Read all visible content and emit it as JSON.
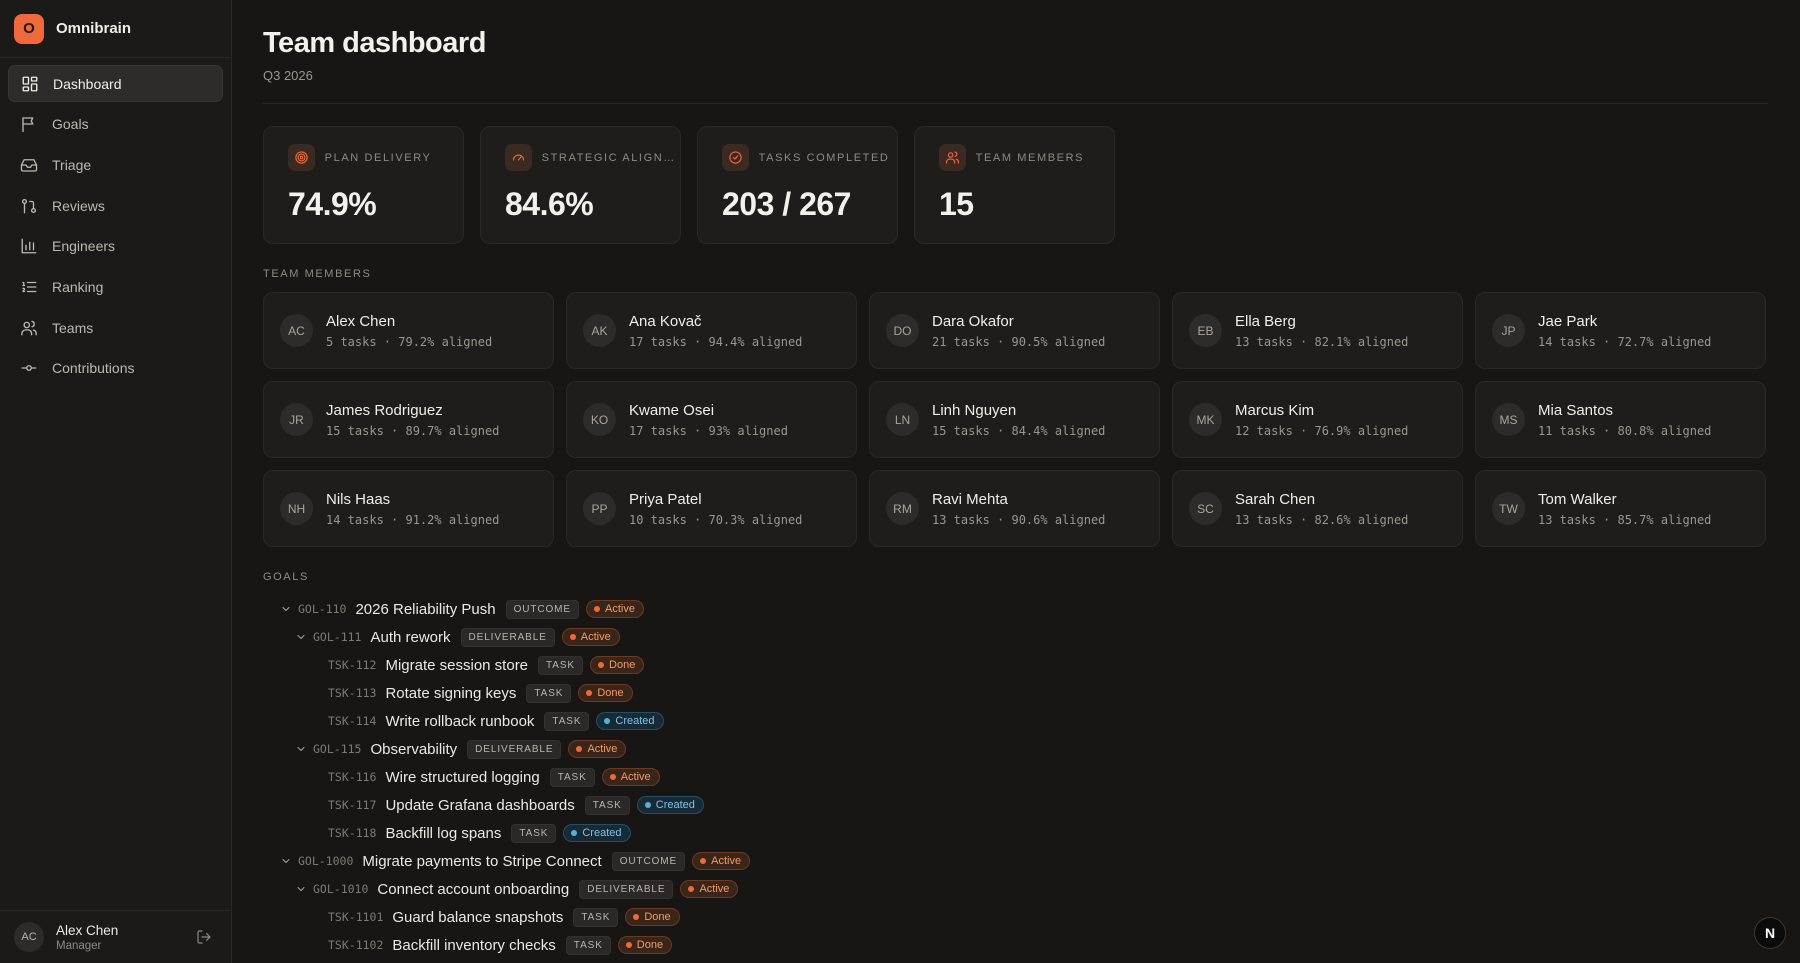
{
  "brand": {
    "logo_letter": "O",
    "name": "Omnibrain",
    "accent": "#f0693a"
  },
  "sidebar": {
    "items": [
      {
        "label": "Dashboard",
        "icon": "dashboard-icon",
        "active": true
      },
      {
        "label": "Goals",
        "icon": "flag-icon"
      },
      {
        "label": "Triage",
        "icon": "inbox-icon"
      },
      {
        "label": "Reviews",
        "icon": "git-pull-request-icon"
      },
      {
        "label": "Engineers",
        "icon": "bar-chart-icon"
      },
      {
        "label": "Ranking",
        "icon": "list-ordered-icon"
      },
      {
        "label": "Teams",
        "icon": "users-icon"
      },
      {
        "label": "Contributions",
        "icon": "git-commit-icon"
      }
    ]
  },
  "user": {
    "initials": "AC",
    "name": "Alex Chen",
    "role": "Manager"
  },
  "header": {
    "title": "Team dashboard",
    "subtitle": "Q3 2026"
  },
  "stats": [
    {
      "label": "PLAN DELIVERY",
      "value": "74.9%",
      "icon": "target-icon"
    },
    {
      "label": "STRATEGIC ALIGNMENT",
      "value": "84.6%",
      "icon": "gauge-icon"
    },
    {
      "label": "TASKS COMPLETED",
      "value": "203 / 267",
      "icon": "check-circle-icon"
    },
    {
      "label": "TEAM MEMBERS",
      "value": "15",
      "icon": "users-icon"
    }
  ],
  "members_section": {
    "label": "TEAM MEMBERS"
  },
  "members": [
    {
      "initials": "AC",
      "name": "Alex Chen",
      "meta": "5 tasks · 79.2% aligned"
    },
    {
      "initials": "AK",
      "name": "Ana Kovač",
      "meta": "17 tasks · 94.4% aligned"
    },
    {
      "initials": "DO",
      "name": "Dara Okafor",
      "meta": "21 tasks · 90.5% aligned"
    },
    {
      "initials": "EB",
      "name": "Ella Berg",
      "meta": "13 tasks · 82.1% aligned"
    },
    {
      "initials": "JP",
      "name": "Jae Park",
      "meta": "14 tasks · 72.7% aligned"
    },
    {
      "initials": "JR",
      "name": "James Rodriguez",
      "meta": "15 tasks · 89.7% aligned"
    },
    {
      "initials": "KO",
      "name": "Kwame Osei",
      "meta": "17 tasks · 93% aligned"
    },
    {
      "initials": "LN",
      "name": "Linh Nguyen",
      "meta": "15 tasks · 84.4% aligned"
    },
    {
      "initials": "MK",
      "name": "Marcus Kim",
      "meta": "12 tasks · 76.9% aligned"
    },
    {
      "initials": "MS",
      "name": "Mia Santos",
      "meta": "11 tasks · 80.8% aligned"
    },
    {
      "initials": "NH",
      "name": "Nils Haas",
      "meta": "14 tasks · 91.2% aligned"
    },
    {
      "initials": "PP",
      "name": "Priya Patel",
      "meta": "10 tasks · 70.3% aligned"
    },
    {
      "initials": "RM",
      "name": "Ravi Mehta",
      "meta": "13 tasks · 90.6% aligned"
    },
    {
      "initials": "SC",
      "name": "Sarah Chen",
      "meta": "13 tasks · 82.6% aligned"
    },
    {
      "initials": "TW",
      "name": "Tom Walker",
      "meta": "13 tasks · 85.7% aligned"
    }
  ],
  "goals_section": {
    "label": "GOALS"
  },
  "goals": [
    {
      "level": 0,
      "expandable": true,
      "id": "GOL-110",
      "title": "2026 Reliability Push",
      "type": "OUTCOME",
      "status": "Active",
      "status_color": "orange"
    },
    {
      "level": 1,
      "expandable": true,
      "id": "GOL-111",
      "title": "Auth rework",
      "type": "DELIVERABLE",
      "status": "Active",
      "status_color": "orange"
    },
    {
      "level": 2,
      "expandable": false,
      "id": "TSK-112",
      "title": "Migrate session store",
      "type": "TASK",
      "status": "Done",
      "status_color": "orange"
    },
    {
      "level": 2,
      "expandable": false,
      "id": "TSK-113",
      "title": "Rotate signing keys",
      "type": "TASK",
      "status": "Done",
      "status_color": "orange"
    },
    {
      "level": 2,
      "expandable": false,
      "id": "TSK-114",
      "title": "Write rollback runbook",
      "type": "TASK",
      "status": "Created",
      "status_color": "blue"
    },
    {
      "level": 1,
      "expandable": true,
      "id": "GOL-115",
      "title": "Observability",
      "type": "DELIVERABLE",
      "status": "Active",
      "status_color": "orange"
    },
    {
      "level": 2,
      "expandable": false,
      "id": "TSK-116",
      "title": "Wire structured logging",
      "type": "TASK",
      "status": "Active",
      "status_color": "orange"
    },
    {
      "level": 2,
      "expandable": false,
      "id": "TSK-117",
      "title": "Update Grafana dashboards",
      "type": "TASK",
      "status": "Created",
      "status_color": "blue"
    },
    {
      "level": 2,
      "expandable": false,
      "id": "TSK-118",
      "title": "Backfill log spans",
      "type": "TASK",
      "status": "Created",
      "status_color": "blue"
    },
    {
      "level": 0,
      "expandable": true,
      "id": "GOL-1000",
      "title": "Migrate payments to Stripe Connect",
      "type": "OUTCOME",
      "status": "Active",
      "status_color": "orange"
    },
    {
      "level": 1,
      "expandable": true,
      "id": "GOL-1010",
      "title": "Connect account onboarding",
      "type": "DELIVERABLE",
      "status": "Active",
      "status_color": "orange"
    },
    {
      "level": 2,
      "expandable": false,
      "id": "TSK-1101",
      "title": "Guard balance snapshots",
      "type": "TASK",
      "status": "Done",
      "status_color": "orange"
    },
    {
      "level": 2,
      "expandable": false,
      "id": "TSK-1102",
      "title": "Backfill inventory checks",
      "type": "TASK",
      "status": "Done",
      "status_color": "orange"
    }
  ],
  "fab": {
    "label": "N"
  }
}
